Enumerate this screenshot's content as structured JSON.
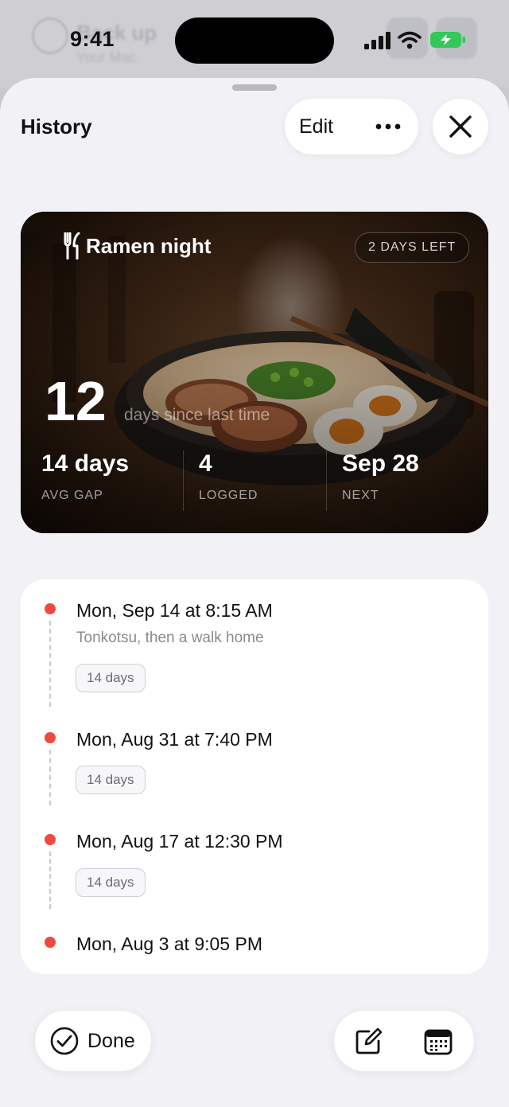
{
  "status_bar": {
    "time": "9:41"
  },
  "background_app": {
    "title": "Back up",
    "subtitle": "Your Mac"
  },
  "header": {
    "title": "History",
    "edit_label": "Edit",
    "more_icon": "ellipsis-icon",
    "close_icon": "close-icon"
  },
  "hero": {
    "title": "Ramen night",
    "icon": "fork-knife-icon",
    "badge": "2 DAYS LEFT",
    "count": "12",
    "count_caption": "days since last time",
    "stats": [
      {
        "value": "14 days",
        "label": "AVG GAP"
      },
      {
        "value": "4",
        "label": "LOGGED"
      },
      {
        "value": "Sep 28",
        "label": "NEXT"
      }
    ]
  },
  "timeline": [
    {
      "title": "Mon, Sep 14 at 8:15 AM",
      "note": "Tonkotsu, then a walk home",
      "gap": "14 days"
    },
    {
      "title": "Mon, Aug 31 at 7:40 PM",
      "note": "",
      "gap": "14 days"
    },
    {
      "title": "Mon, Aug 17 at 12:30 PM",
      "note": "",
      "gap": "14 days"
    },
    {
      "title": "Mon, Aug 3 at 9:05 PM",
      "note": "",
      "gap": ""
    }
  ],
  "toolbar": {
    "done_label": "Done",
    "done_icon": "checkmark-circle-icon",
    "compose_icon": "compose-icon",
    "calendar_icon": "calendar-icon"
  },
  "colors": {
    "accent_dot": "#f04a3e",
    "sheet_bg": "#f2f2f6",
    "battery_green": "#34c759"
  }
}
